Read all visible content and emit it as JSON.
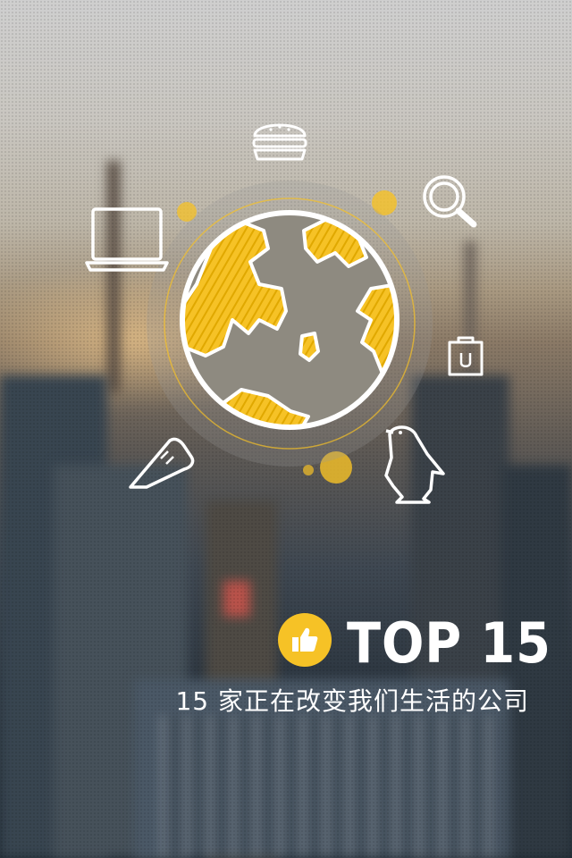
{
  "headline": "TOP 15",
  "subline": "15 家正在改变我们生活的公司",
  "colors": {
    "accent": "#F6C226",
    "line": "#FFFFFF"
  },
  "icons": [
    "burger-icon",
    "laptop-icon",
    "search-icon",
    "scale-icon",
    "sneaker-icon",
    "penguin-icon",
    "globe-icon",
    "thumbs-up-icon"
  ]
}
